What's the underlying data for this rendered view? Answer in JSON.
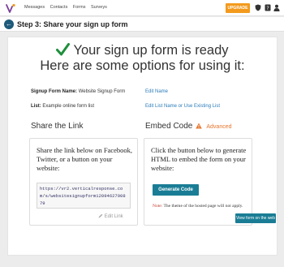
{
  "topbar": {
    "nav": [
      "Messages",
      "Contacts",
      "Forms",
      "Surveys"
    ],
    "upgrade_label": "UPGRADE",
    "icons": [
      "shield-icon",
      "help-icon",
      "user-icon"
    ]
  },
  "step": {
    "title": "Step 3: Share your sign up form"
  },
  "hero": {
    "line1": "Your sign up form is ready",
    "line2": "Here are some options for using it:"
  },
  "details": {
    "form_name_label": "Signup Form Name:",
    "form_name_value": "Website Signup Form",
    "edit_name": "Edit Name",
    "list_label": "List:",
    "list_value": "Example online form list",
    "edit_list": "Edit List Name or Use Existing List"
  },
  "share": {
    "heading": "Share the Link",
    "text": "Share the link below on Facebook, Twitter, or a button on your website:",
    "url": "https://vr2.verticalresponse.com/s/websitesignupform1209462790879",
    "edit_link": "Edit Link"
  },
  "embed": {
    "heading": "Embed Code",
    "advanced": "Advanced",
    "text": "Click the button below to generate HTML to embed the form on your website:",
    "button": "Generate Code",
    "note_label": "Note:",
    "note_text": "The theme of the hosted page will not apply."
  },
  "footer": {
    "view_button": "View form on the web"
  },
  "colors": {
    "accent": "#1a7d95",
    "upgrade": "#f39a1d",
    "check": "#1e8f3c",
    "link": "#2a7bb8"
  }
}
